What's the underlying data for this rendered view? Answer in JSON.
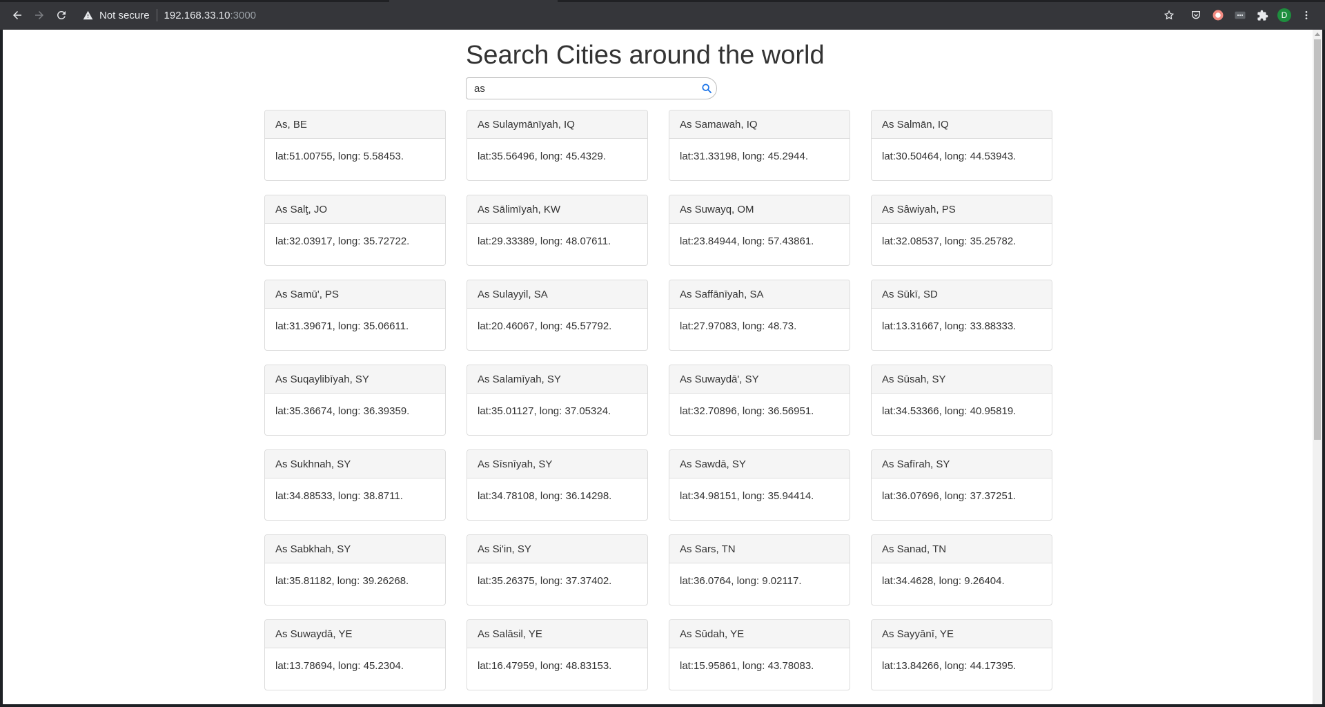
{
  "browser": {
    "security_label": "Not secure",
    "url_host": "192.168.33.10",
    "url_port": ":3000",
    "profile_initial": "D"
  },
  "page": {
    "title": "Search Cities around the world",
    "search": {
      "value": "as",
      "placeholder": ""
    }
  },
  "cities": [
    {
      "name": "As, BE",
      "coords": "lat:51.00755, long: 5.58453."
    },
    {
      "name": "As Sulaymānīyah, IQ",
      "coords": "lat:35.56496, long: 45.4329."
    },
    {
      "name": "As Samawah, IQ",
      "coords": "lat:31.33198, long: 45.2944."
    },
    {
      "name": "As Salmān, IQ",
      "coords": "lat:30.50464, long: 44.53943."
    },
    {
      "name": "As Salţ, JO",
      "coords": "lat:32.03917, long: 35.72722."
    },
    {
      "name": "As Sālimīyah, KW",
      "coords": "lat:29.33389, long: 48.07611."
    },
    {
      "name": "As Suwayq, OM",
      "coords": "lat:23.84944, long: 57.43861."
    },
    {
      "name": "As Sâwiyah, PS",
      "coords": "lat:32.08537, long: 35.25782."
    },
    {
      "name": "As Samū', PS",
      "coords": "lat:31.39671, long: 35.06611."
    },
    {
      "name": "As Sulayyil, SA",
      "coords": "lat:20.46067, long: 45.57792."
    },
    {
      "name": "As Saffānīyah, SA",
      "coords": "lat:27.97083, long: 48.73."
    },
    {
      "name": "As Sūkī, SD",
      "coords": "lat:13.31667, long: 33.88333."
    },
    {
      "name": "As Suqaylibīyah, SY",
      "coords": "lat:35.36674, long: 36.39359."
    },
    {
      "name": "As Salamīyah, SY",
      "coords": "lat:35.01127, long: 37.05324."
    },
    {
      "name": "As Suwaydā', SY",
      "coords": "lat:32.70896, long: 36.56951."
    },
    {
      "name": "As Sūsah, SY",
      "coords": "lat:34.53366, long: 40.95819."
    },
    {
      "name": "As Sukhnah, SY",
      "coords": "lat:34.88533, long: 38.8711."
    },
    {
      "name": "As Sīsnīyah, SY",
      "coords": "lat:34.78108, long: 36.14298."
    },
    {
      "name": "As Sawdā, SY",
      "coords": "lat:34.98151, long: 35.94414."
    },
    {
      "name": "As Safīrah, SY",
      "coords": "lat:36.07696, long: 37.37251."
    },
    {
      "name": "As Sabkhah, SY",
      "coords": "lat:35.81182, long: 39.26268."
    },
    {
      "name": "As Si'in, SY",
      "coords": "lat:35.26375, long: 37.37402."
    },
    {
      "name": "As Sars, TN",
      "coords": "lat:36.0764, long: 9.02117."
    },
    {
      "name": "As Sanad, TN",
      "coords": "lat:34.4628, long: 9.26404."
    },
    {
      "name": "As Suwaydā, YE",
      "coords": "lat:13.78694, long: 45.2304."
    },
    {
      "name": "As Salāsil, YE",
      "coords": "lat:16.47959, long: 48.83153."
    },
    {
      "name": "As Sūdah, YE",
      "coords": "lat:15.95861, long: 43.78083."
    },
    {
      "name": "As Sayyānī, YE",
      "coords": "lat:13.84266, long: 44.17395."
    }
  ]
}
